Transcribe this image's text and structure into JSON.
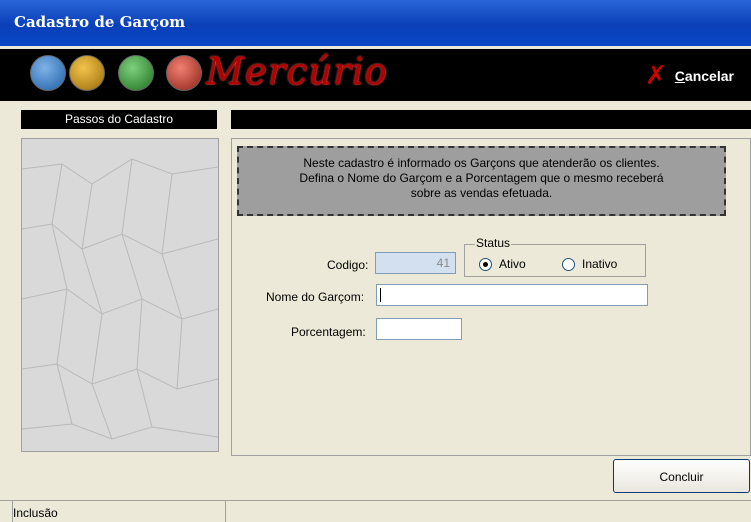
{
  "window": {
    "title": "Cadastro de Garçom"
  },
  "toolbar": {
    "logo_text": "Mercúrio",
    "cancel_label_first": "C",
    "cancel_label_rest": "ancelar",
    "icons": [
      {
        "name": "map-icon",
        "color": "#2E6FB6"
      },
      {
        "name": "folder-icon",
        "color": "#C08A10"
      },
      {
        "name": "person-icon",
        "color": "#2E8B2E"
      },
      {
        "name": "chart-icon",
        "color": "#C0392B"
      }
    ]
  },
  "steps": {
    "header": "Passos do Cadastro"
  },
  "info": {
    "lines": [
      "Neste cadastro é informado os Garçons que atenderão os clientes.",
      "Defina o Nome do Garçom e a Porcentagem que o mesmo receberá",
      "sobre as vendas efetuada."
    ]
  },
  "form": {
    "codigo_label": "Codigo:",
    "codigo_value": "41",
    "nome_label": "Nome do Garçom:",
    "nome_value": "",
    "porcentagem_label": "Porcentagem:",
    "porcentagem_value": "",
    "status_legend": "Status",
    "status_options": [
      "Ativo",
      "Inativo"
    ],
    "status_selected": "Ativo"
  },
  "footer": {
    "concluir_label": "Concluir"
  },
  "statusbar": {
    "mode": "Inclusão"
  }
}
